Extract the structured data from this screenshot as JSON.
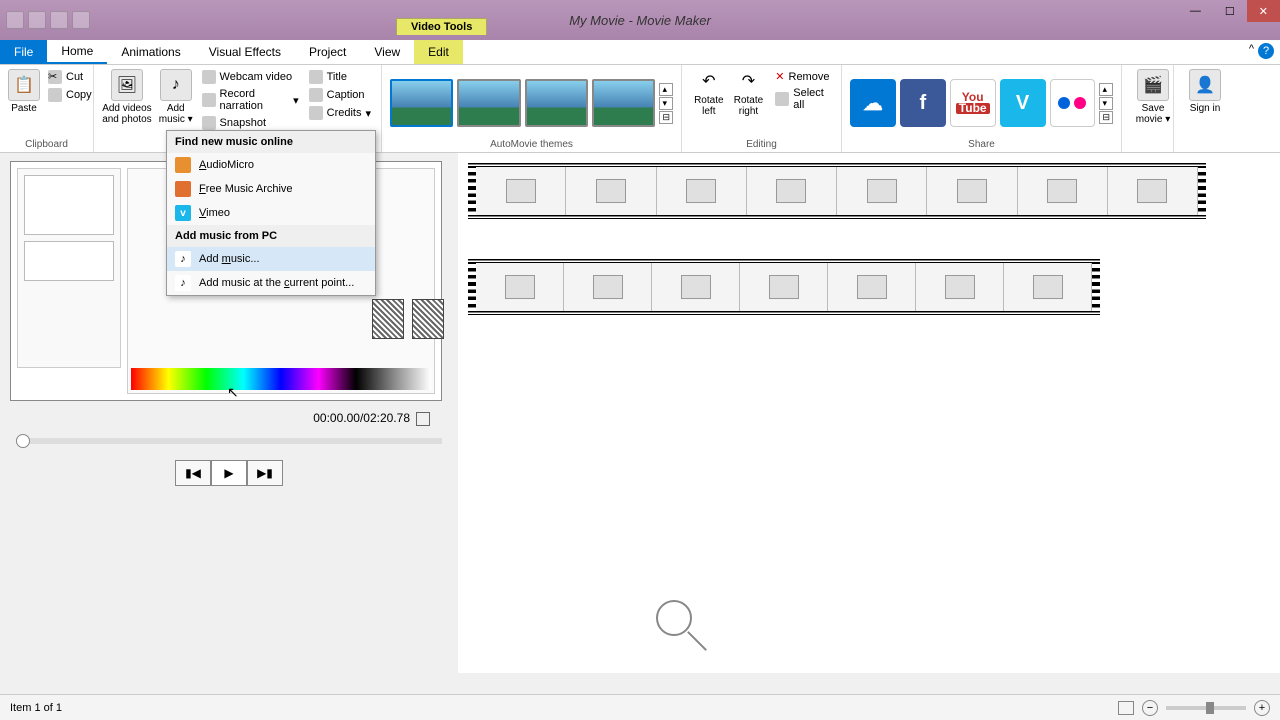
{
  "title": "My Movie - Movie Maker",
  "video_tools": "Video Tools",
  "menu": {
    "file": "File",
    "home": "Home",
    "animations": "Animations",
    "visual_effects": "Visual Effects",
    "project": "Project",
    "view": "View",
    "edit": "Edit"
  },
  "clipboard": {
    "label": "Clipboard",
    "paste": "Paste",
    "cut": "Cut",
    "copy": "Copy"
  },
  "add": {
    "videos_photos": "Add videos and photos",
    "music": "Add music",
    "webcam": "Webcam video",
    "narration": "Record narration",
    "snapshot": "Snapshot",
    "title": "Title",
    "caption": "Caption",
    "credits": "Credits"
  },
  "themes_label": "AutoMovie themes",
  "editing": {
    "label": "Editing",
    "rotate_left": "Rotate left",
    "rotate_right": "Rotate right",
    "remove": "Remove",
    "select_all": "Select all"
  },
  "share": {
    "label": "Share",
    "onedrive": "OneDrive",
    "facebook": "f",
    "youtube_top": "You",
    "youtube_bottom": "Tube",
    "vimeo": "V",
    "flickr": "flickr"
  },
  "save_movie": "Save movie",
  "sign_in": "Sign in",
  "dropdown": {
    "online_header": "Find new music online",
    "audiomicro": "AudioMicro",
    "fma": "Free Music Archive",
    "vimeo": "Vimeo",
    "pc_header": "Add music from PC",
    "add_music": "Add music...",
    "add_current": "Add music at the current point..."
  },
  "preview": {
    "time": "00:00.00/02:20.78"
  },
  "status": {
    "item": "Item 1 of 1"
  },
  "timeline": {
    "row1_clips": 8,
    "row2_clips": 7
  }
}
